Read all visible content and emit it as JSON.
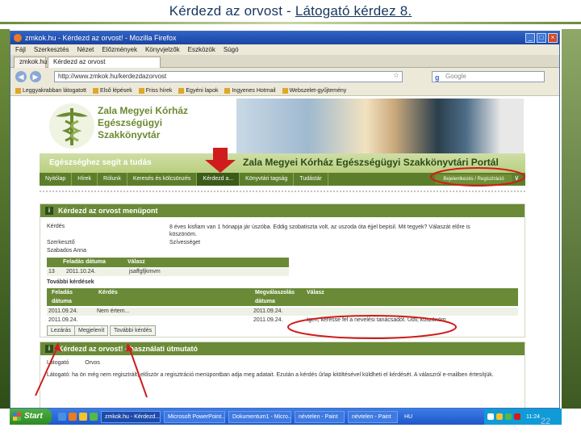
{
  "slide": {
    "title_prefix": "Kérdezd az orvost - ",
    "title_highlight": "Látogató  kérdez 8.",
    "number": "22"
  },
  "browser": {
    "title": "zmkok.hu - Kérdezd az orvost! - Mozilla Firefox",
    "menu": [
      "Fájl",
      "Szerkesztés",
      "Nézet",
      "Előzmények",
      "Könyvjelzők",
      "Eszközök",
      "Súgó"
    ],
    "tabs": [
      "zmkok.hu",
      "Kérdezd az orvost"
    ],
    "url": "http://www.zmkok.hu/kerdezdazorvost",
    "search_placeholder": "Google",
    "bookmarks": [
      "Leggyakrabban látogatott",
      "Első lépések",
      "Friss hírek",
      "Egyéni lapok",
      "Ingyenes Hotmail",
      "Webszelet-gyűjtemény"
    ]
  },
  "site": {
    "name_lines": [
      "Zala Megyei Kórház",
      "Egészségügyi",
      "Szakkönyvtár"
    ],
    "slogan": "Egészséghez segít a tudás",
    "portal_title": "Zala Megyei Kórház Egészségügyi Szakkönyvtári Portál",
    "menu": [
      "Nyitólap",
      "Hírek",
      "Rólunk",
      "Keresés és kölcsönzés",
      "Kérdezd a...",
      "Könyvtári tagság",
      "Tudástár"
    ],
    "login": "Bejelentkezés / Regisztráció"
  },
  "question_section": {
    "header": "Kérdezd az orvost menüpont",
    "question_label": "Kérdés",
    "question_text": "8 éves kisfiam van 1 hónapja jár úszóba. Eddig szobatiszta volt, az uszoda óta éjjel bepisil. Mit tegyek? Válaszát előre is köszönöm.",
    "answer_label": "Szívességet",
    "author_label": "Szerkesztő",
    "author_name": "Szabados Anna",
    "columns": [
      "Feladás dátuma",
      "Válasz"
    ],
    "row": [
      "13",
      "2011.10.24.",
      "jsaffgfjkmvm"
    ]
  },
  "more_questions": {
    "header": "További kérdések",
    "columns": [
      "Feladás dátuma",
      "Kérdés",
      "Megválaszolás dátuma",
      "Válasz"
    ],
    "rows": [
      [
        "2011.09.24.",
        "Nem értem...",
        "2011.09.24.",
        ""
      ],
      [
        "2011.09.24.",
        "",
        "2011.09.24.",
        "Igen, keresse fel a nevelési tanácsadót. Üdv, köszönöm"
      ]
    ],
    "buttons": [
      "Lezárás",
      "Megjelenít",
      "További kérdés"
    ]
  },
  "usage_section": {
    "header": "Kérdezd az orvost! - használati útmutató",
    "tabs": [
      "Látogató",
      "Orvos"
    ],
    "text": "Látogató: ha ön még nem regisztrált, először a regisztráció menüpontban adja meg adatait. Ezután a kérdés űrlap kitöltésével küldheti el kérdését. A válaszról e-mailben értesítjük."
  },
  "taskbar": {
    "start": "Start",
    "tasks": [
      "zmkok.hu - Kérdezd...",
      "Microsoft PowerPoint...",
      "Dokumentum1 - Micro...",
      "névtelen - Paint",
      "névtelen - Paint"
    ],
    "lang": "HU",
    "clock": "11:24"
  },
  "colors": {
    "site_green": "#6a8a37",
    "annotation_red": "#d01c1c",
    "slide_title": "#17375e"
  }
}
